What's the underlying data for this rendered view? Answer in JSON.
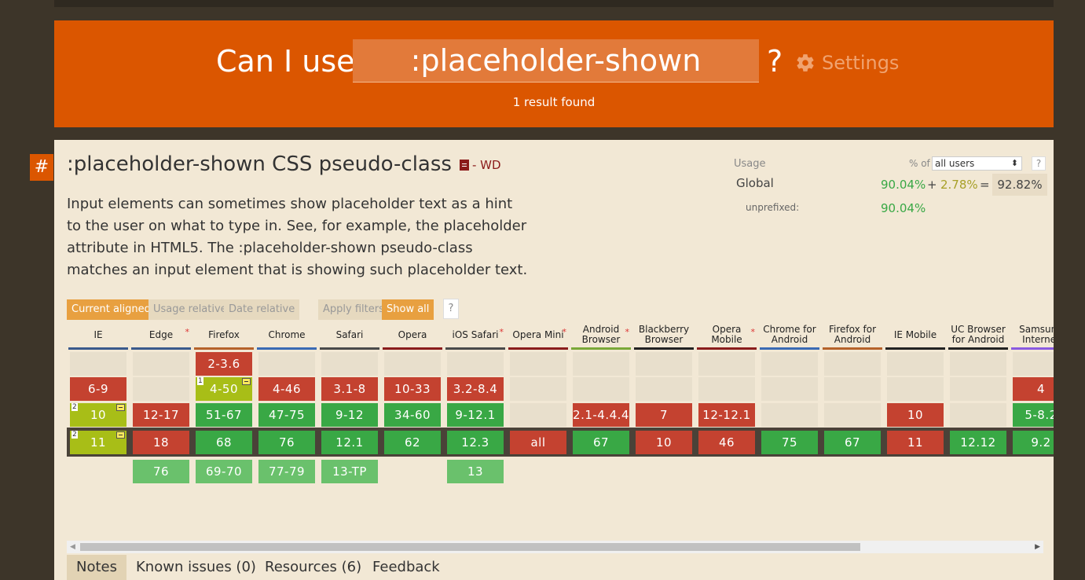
{
  "header": {
    "title": "Can I use",
    "search_value": ":placeholder-shown",
    "question_mark": "?",
    "settings_label": "Settings",
    "results": "1 result found"
  },
  "feature": {
    "anchor": "#",
    "title": ":placeholder-shown CSS pseudo-class",
    "status": "- WD",
    "description": "Input elements can sometimes show placeholder text as a hint to the user on what to type in. See, for example, the placeholder attribute in HTML5. The :placeholder-shown pseudo-class matches an input element that is showing such placeholder text."
  },
  "usage": {
    "label": "Usage",
    "pct_of": "% of",
    "users_option": "all users",
    "help": "?",
    "global_label": "Global",
    "supported": "90.04%",
    "plus": "+",
    "partial": "2.78%",
    "equals": "=",
    "total": "92.82%",
    "unprefixed_label": "unprefixed:",
    "unprefixed_value": "90.04%"
  },
  "filters": {
    "current_aligned": "Current aligned",
    "usage_relative": "Usage relative",
    "date_relative": "Date relative",
    "apply_filters": "Apply filters",
    "show_all": "Show all",
    "help": "?"
  },
  "colors": {
    "supported": "#39a845",
    "unsupported": "#c44230",
    "partial": "#a8be17",
    "future": "#6ac16c",
    "accent": "#db5600"
  },
  "browsers": [
    {
      "name": "IE",
      "star": false,
      "color": "#3a5a8c",
      "cells": [
        {
          "row": "p2",
          "v": "",
          "s": "u"
        },
        {
          "row": "p1",
          "v": "6-9",
          "s": "n"
        },
        {
          "row": "p0",
          "v": "10",
          "s": "a",
          "note": "2",
          "flag": true
        },
        {
          "row": "cur",
          "v": "11",
          "s": "a",
          "note": "2",
          "flag": true
        }
      ]
    },
    {
      "name": "Edge",
      "star": true,
      "color": "#3a5a8c",
      "cells": [
        {
          "row": "p2",
          "v": "",
          "s": "u"
        },
        {
          "row": "p1",
          "v": "",
          "s": "u"
        },
        {
          "row": "p0",
          "v": "12-17",
          "s": "n"
        },
        {
          "row": "cur",
          "v": "18",
          "s": "n"
        },
        {
          "row": "f1",
          "v": "76",
          "s": "f"
        }
      ]
    },
    {
      "name": "Firefox",
      "star": false,
      "color": "#b5622a",
      "cells": [
        {
          "row": "p3",
          "v": "2-3.6",
          "s": "n"
        },
        {
          "row": "p1",
          "v": "4-50",
          "s": "a",
          "note": "1",
          "flag": true
        },
        {
          "row": "p0",
          "v": "51-67",
          "s": "y"
        },
        {
          "row": "cur",
          "v": "68",
          "s": "y"
        },
        {
          "row": "f1",
          "v": "69-70",
          "s": "f"
        }
      ]
    },
    {
      "name": "Chrome",
      "star": false,
      "color": "#3a6ab4",
      "cells": [
        {
          "row": "p2",
          "v": "",
          "s": "u"
        },
        {
          "row": "p1",
          "v": "4-46",
          "s": "n"
        },
        {
          "row": "p0",
          "v": "47-75",
          "s": "y"
        },
        {
          "row": "cur",
          "v": "76",
          "s": "y"
        },
        {
          "row": "f1",
          "v": "77-79",
          "s": "f"
        }
      ]
    },
    {
      "name": "Safari",
      "star": false,
      "color": "#4a4a4a",
      "cells": [
        {
          "row": "p2",
          "v": "",
          "s": "u"
        },
        {
          "row": "p1",
          "v": "3.1-8",
          "s": "n"
        },
        {
          "row": "p0",
          "v": "9-12",
          "s": "y"
        },
        {
          "row": "cur",
          "v": "12.1",
          "s": "y"
        },
        {
          "row": "f1",
          "v": "13-TP",
          "s": "f"
        }
      ]
    },
    {
      "name": "Opera",
      "star": false,
      "color": "#8a1c1c",
      "cells": [
        {
          "row": "p2",
          "v": "",
          "s": "u"
        },
        {
          "row": "p1",
          "v": "10-33",
          "s": "n"
        },
        {
          "row": "p0",
          "v": "34-60",
          "s": "y"
        },
        {
          "row": "cur",
          "v": "62",
          "s": "y"
        }
      ]
    },
    {
      "name": "iOS Safari",
      "star": true,
      "color": "#4a4a4a",
      "cells": [
        {
          "row": "p2",
          "v": "",
          "s": "u"
        },
        {
          "row": "p1",
          "v": "3.2-8.4",
          "s": "n"
        },
        {
          "row": "p0",
          "v": "9-12.1",
          "s": "y"
        },
        {
          "row": "cur",
          "v": "12.3",
          "s": "y"
        },
        {
          "row": "f1",
          "v": "13",
          "s": "f"
        }
      ]
    },
    {
      "name": "Opera Mini",
      "star": true,
      "color": "#8a1c1c",
      "cells": [
        {
          "row": "p2",
          "v": "",
          "s": "u"
        },
        {
          "row": "p1",
          "v": "",
          "s": "u"
        },
        {
          "row": "p0",
          "v": "",
          "s": "u"
        },
        {
          "row": "cur",
          "v": "all",
          "s": "n"
        }
      ]
    },
    {
      "name": "Android Browser",
      "star": true,
      "color": "#7aa838",
      "cells": [
        {
          "row": "p2",
          "v": "",
          "s": "u"
        },
        {
          "row": "p1",
          "v": "",
          "s": "u"
        },
        {
          "row": "p0",
          "v": "2.1-4.4.4",
          "s": "n"
        },
        {
          "row": "cur",
          "v": "67",
          "s": "y"
        }
      ]
    },
    {
      "name": "Blackberry Browser",
      "star": false,
      "color": "#222222",
      "cells": [
        {
          "row": "p2",
          "v": "",
          "s": "u"
        },
        {
          "row": "p1",
          "v": "",
          "s": "u"
        },
        {
          "row": "p0",
          "v": "7",
          "s": "n"
        },
        {
          "row": "cur",
          "v": "10",
          "s": "n"
        }
      ]
    },
    {
      "name": "Opera Mobile",
      "star": true,
      "color": "#8a1c1c",
      "cells": [
        {
          "row": "p2",
          "v": "",
          "s": "u"
        },
        {
          "row": "p1",
          "v": "",
          "s": "u"
        },
        {
          "row": "p0",
          "v": "12-12.1",
          "s": "n"
        },
        {
          "row": "cur",
          "v": "46",
          "s": "n"
        }
      ]
    },
    {
      "name": "Chrome for Android",
      "star": false,
      "color": "#3a6ab4",
      "cells": [
        {
          "row": "p2",
          "v": "",
          "s": "u"
        },
        {
          "row": "p1",
          "v": "",
          "s": "u"
        },
        {
          "row": "p0",
          "v": "",
          "s": "u"
        },
        {
          "row": "cur",
          "v": "75",
          "s": "y"
        }
      ]
    },
    {
      "name": "Firefox for Android",
      "star": false,
      "color": "#b5622a",
      "cells": [
        {
          "row": "p2",
          "v": "",
          "s": "u"
        },
        {
          "row": "p1",
          "v": "",
          "s": "u"
        },
        {
          "row": "p0",
          "v": "",
          "s": "u"
        },
        {
          "row": "cur",
          "v": "67",
          "s": "y"
        }
      ]
    },
    {
      "name": "IE Mobile",
      "star": false,
      "color": "#222222",
      "cells": [
        {
          "row": "p2",
          "v": "",
          "s": "u"
        },
        {
          "row": "p1",
          "v": "",
          "s": "u"
        },
        {
          "row": "p0",
          "v": "10",
          "s": "n"
        },
        {
          "row": "cur",
          "v": "11",
          "s": "n"
        }
      ]
    },
    {
      "name": "UC Browser for Android",
      "star": false,
      "color": "#222222",
      "cells": [
        {
          "row": "p2",
          "v": "",
          "s": "u"
        },
        {
          "row": "p1",
          "v": "",
          "s": "u"
        },
        {
          "row": "p0",
          "v": "",
          "s": "u"
        },
        {
          "row": "cur",
          "v": "12.12",
          "s": "y"
        }
      ]
    },
    {
      "name": "Samsung Internet",
      "star": false,
      "color": "#8a5ae0",
      "cells": [
        {
          "row": "p2",
          "v": "",
          "s": "u"
        },
        {
          "row": "p1",
          "v": "4",
          "s": "n"
        },
        {
          "row": "p0",
          "v": "5-8.2",
          "s": "y"
        },
        {
          "row": "cur",
          "v": "9.2",
          "s": "y"
        }
      ]
    }
  ],
  "tabs": [
    {
      "label": "Notes",
      "active": true
    },
    {
      "label": "Known issues (0)",
      "active": false
    },
    {
      "label": "Resources (6)",
      "active": false
    },
    {
      "label": "Feedback",
      "active": false
    }
  ]
}
